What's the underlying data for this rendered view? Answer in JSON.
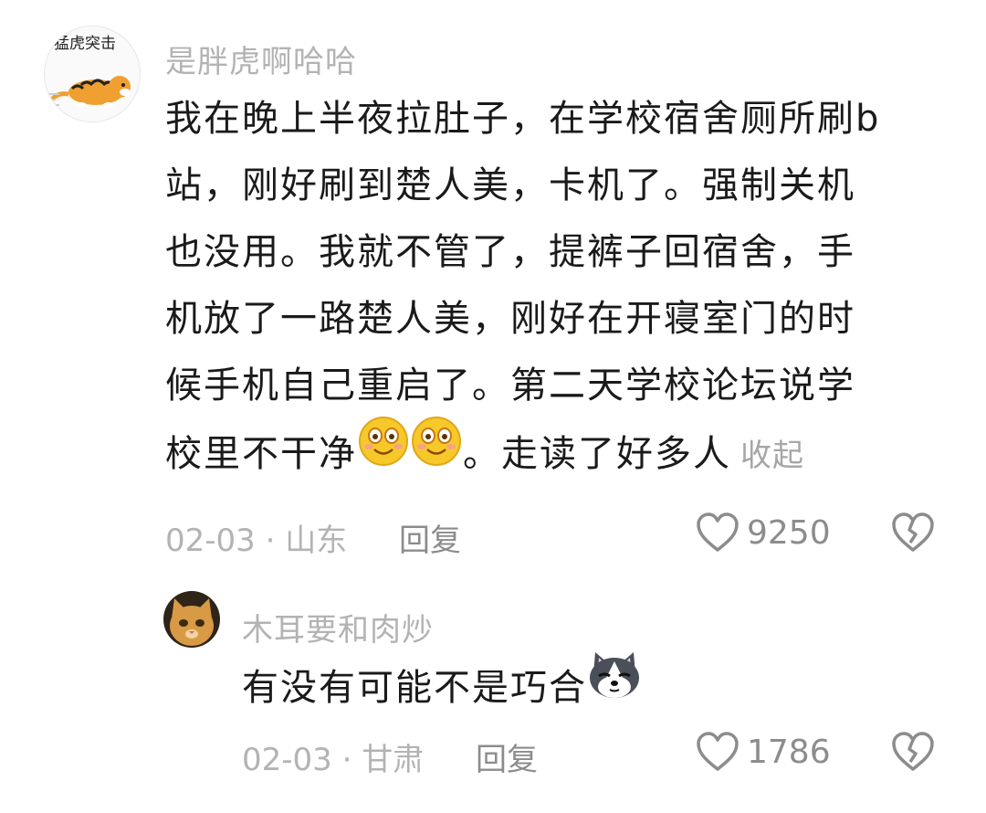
{
  "comments": [
    {
      "avatar_text": "猛虎突击",
      "username": "是胖虎啊哈哈",
      "lines": [
        "我在晚上半夜拉肚子，在学校宿舍厕所刷b",
        "站，刚好刷到楚人美，卡机了。强制关机",
        "也没用。我就不管了，提裤子回宿舍，手",
        "机放了一路楚人美，刚好在开寝室门的时",
        "候手机自己重启了。第二天学校论坛说学"
      ],
      "last_line_before": "校里不干净",
      "last_line_after": "。走读了好多人",
      "collapse_label": "收起",
      "date_location": "02-03 · 山东",
      "reply_label": "回复",
      "likes": "9250",
      "icons": [
        "tiger-avatar",
        "smile-emoji",
        "heart-icon",
        "broken-heart-icon"
      ]
    },
    {
      "username": "木耳要和肉炒",
      "text": "有没有可能不是巧合",
      "date_location": "02-03 · 甘肃",
      "reply_label": "回复",
      "likes": "1786",
      "icons": [
        "cat-avatar",
        "husky-emoji",
        "heart-icon",
        "broken-heart-icon"
      ]
    }
  ],
  "colors": {
    "username": "#b3b3b3",
    "text": "#1a1a1a",
    "meta": "#8c8c8c",
    "emoji_yellow": "#f7c82a"
  }
}
